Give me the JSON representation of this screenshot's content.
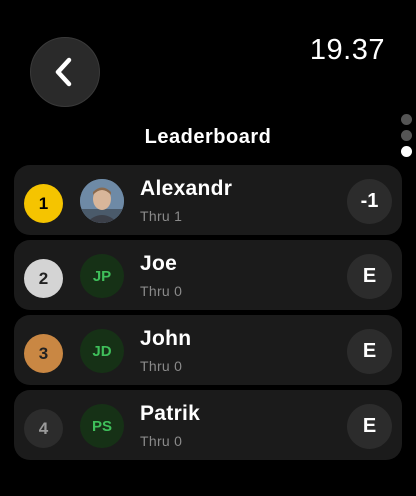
{
  "status": {
    "time": "19.37"
  },
  "header": {
    "title": "Leaderboard"
  },
  "colors": {
    "rank_gold": "#f5c400",
    "rank_silver": "#d4d4d4",
    "rank_bronze": "#c98743",
    "rank_default": "#2c2c2c",
    "initials_green": "#3fbf5a"
  },
  "players": [
    {
      "rank": "1",
      "name": "Alexandr",
      "thru": "Thru 1",
      "score": "-1",
      "avatar": "photo",
      "initials": ""
    },
    {
      "rank": "2",
      "name": "Joe",
      "thru": "Thru 0",
      "score": "E",
      "avatar": "initials",
      "initials": "JP"
    },
    {
      "rank": "3",
      "name": "John",
      "thru": "Thru 0",
      "score": "E",
      "avatar": "initials",
      "initials": "JD"
    },
    {
      "rank": "4",
      "name": "Patrik",
      "thru": "Thru 0",
      "score": "E",
      "avatar": "initials",
      "initials": "PS"
    }
  ],
  "page_indicator": {
    "count": 3,
    "active_index": 2
  },
  "icons": {
    "back": "chevron-left-icon"
  }
}
